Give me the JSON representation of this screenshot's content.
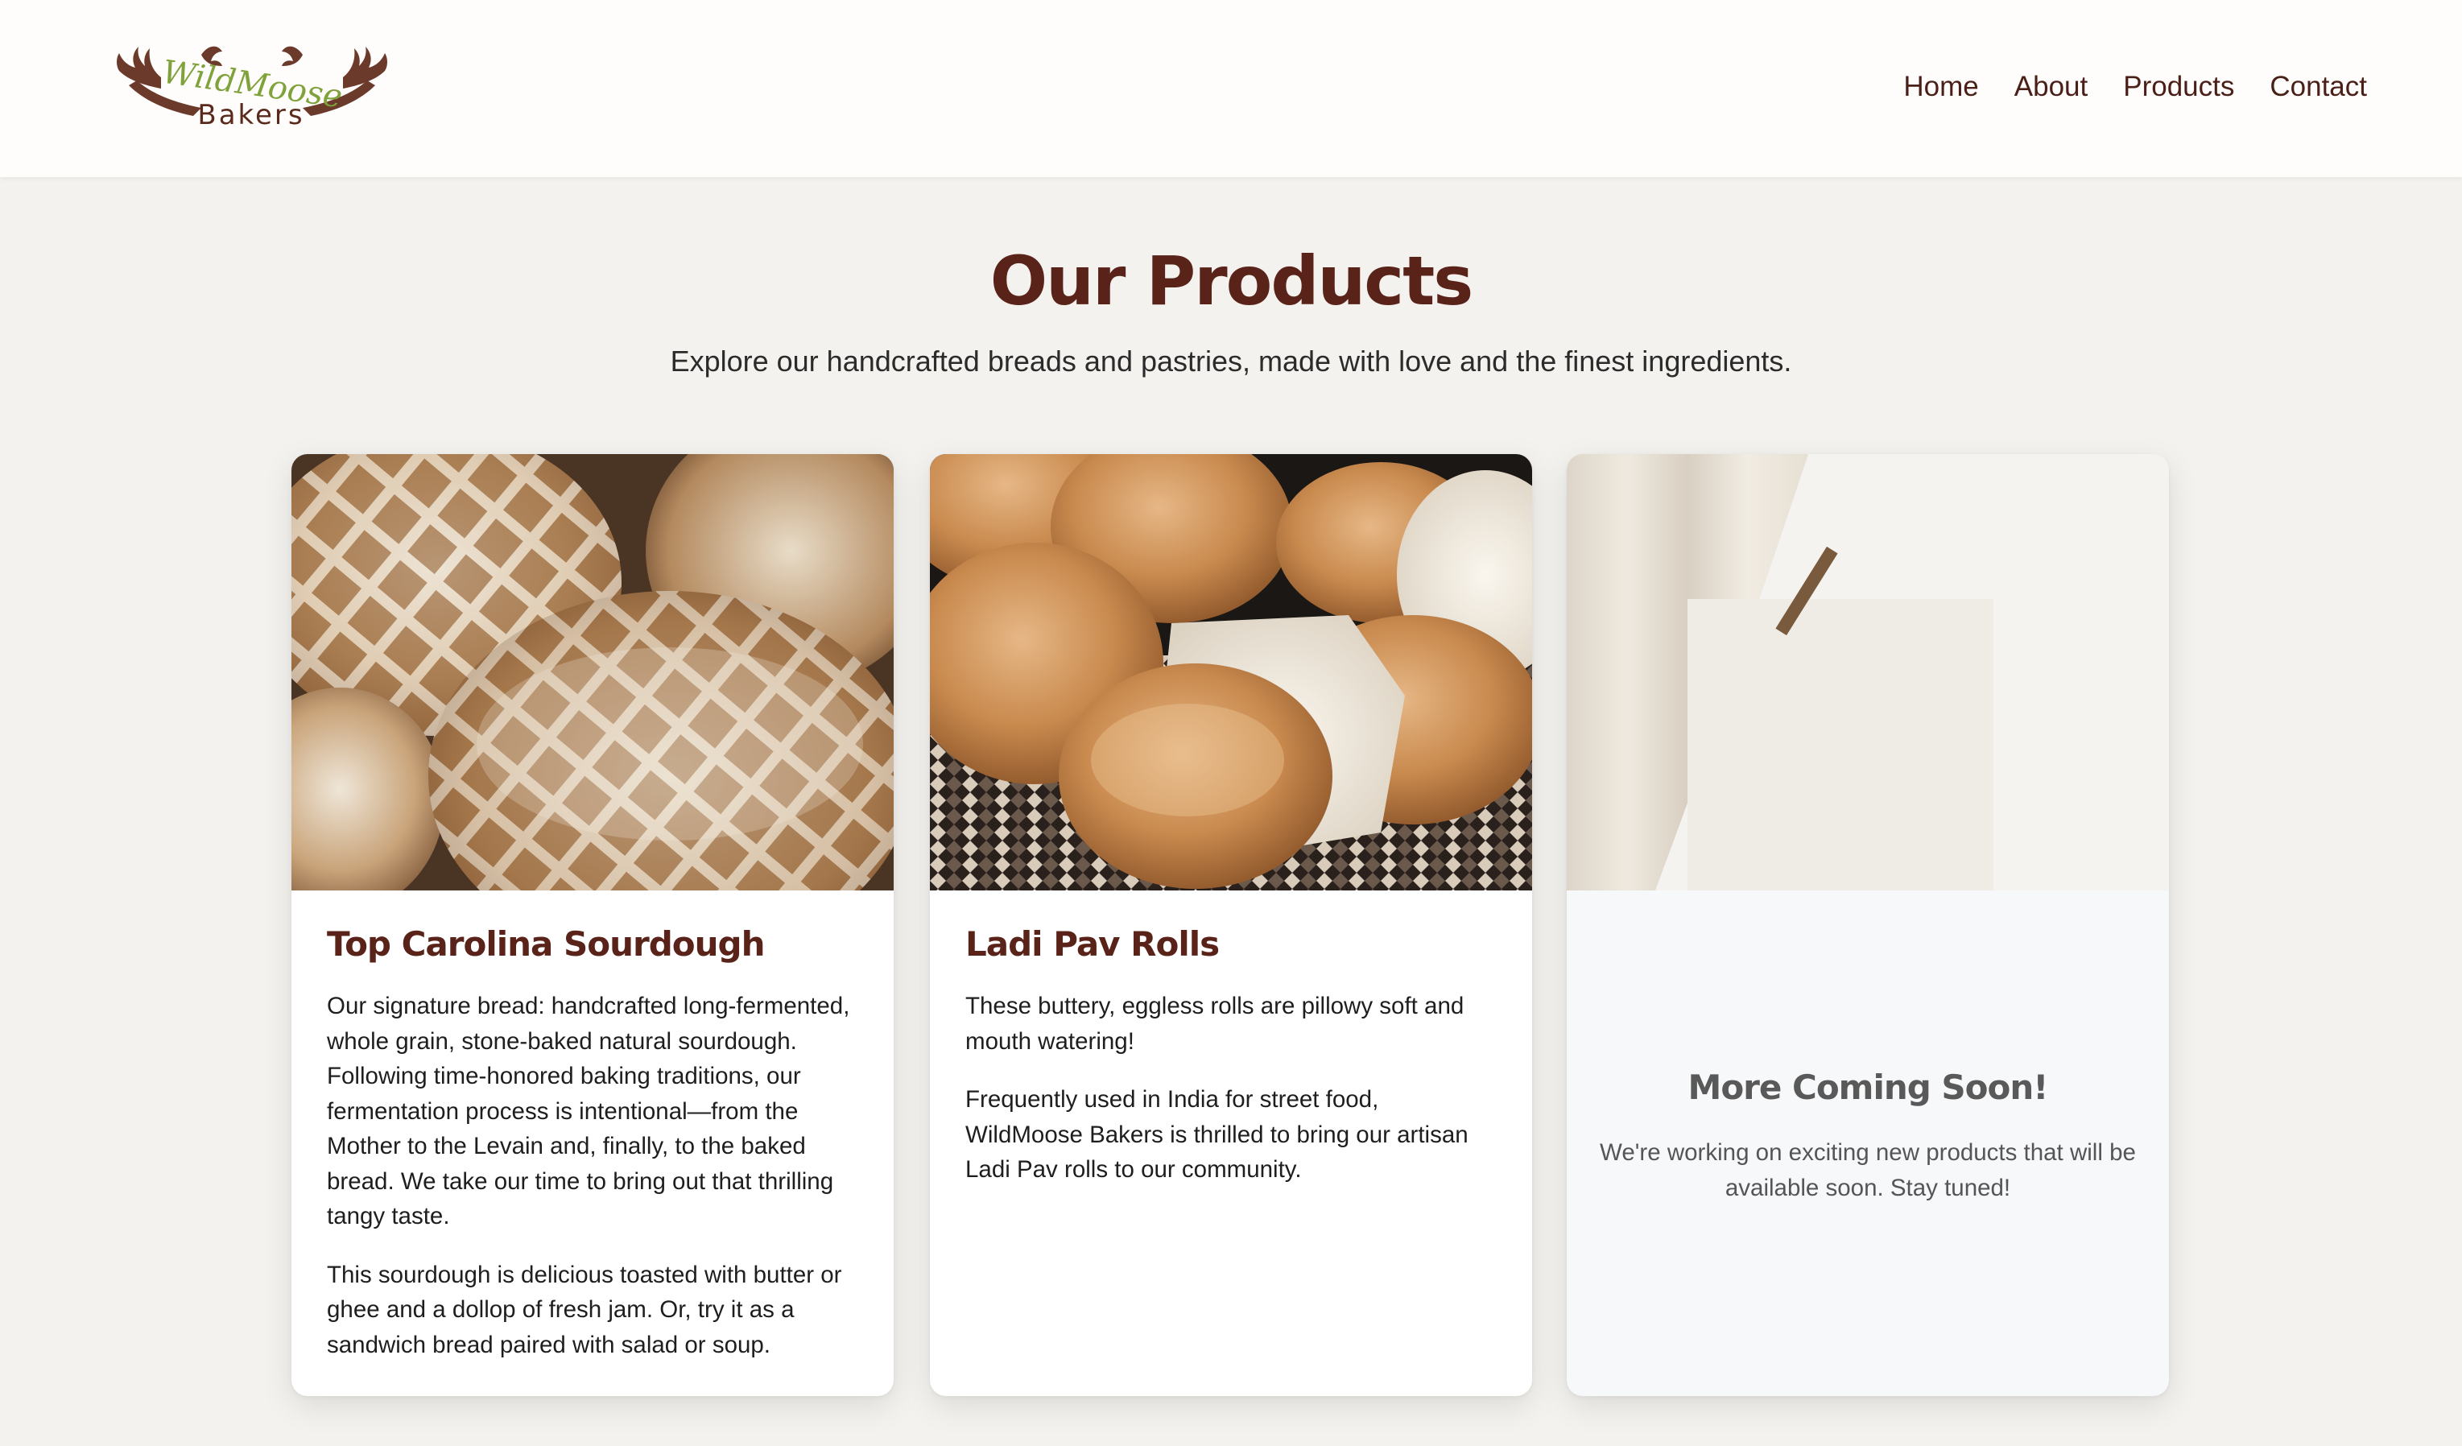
{
  "header": {
    "logo": {
      "line1": "WildMoose",
      "line2": "Bakers",
      "icon": "moose-antler-logo"
    },
    "nav": [
      "Home",
      "About",
      "Products",
      "Contact"
    ]
  },
  "intro": {
    "title": "Our Products",
    "subtitle": "Explore our handcrafted breads and pastries, made with love and the finest ingredients."
  },
  "products": [
    {
      "image": "sourdough-loaves-photo",
      "title": "Top Carolina Sourdough",
      "paragraphs": [
        "Our signature bread: handcrafted long-fermented, whole grain, stone-baked natural sourdough. Following time-honored baking traditions, our fermentation process is intentional—from the Mother to the Levain and, finally, to the baked bread. We take our time to bring out that thrilling tangy taste.",
        "This sourdough is delicious toasted with butter or ghee and a dollop of fresh jam. Or, try it as a sandwich bread paired with salad or soup."
      ]
    },
    {
      "image": "pav-rolls-basket-photo",
      "title": "Ladi Pav Rolls",
      "paragraphs": [
        "These buttery, eggless rolls are pillowy soft and mouth watering!",
        "Frequently used in India for street food, WildMoose Bakers is thrilled to bring our artisan Ladi Pav rolls to our community."
      ]
    }
  ],
  "coming_soon": {
    "image": "blank-note-clothespin-photo",
    "title": "More Coming Soon!",
    "text": "We're working on exciting new products that will be available soon. Stay tuned!"
  },
  "colors": {
    "brand": "#5a2319",
    "nav_text": "#4a1f17",
    "logo_green": "#7fa23a",
    "page_bg": "#f3f2ee"
  }
}
